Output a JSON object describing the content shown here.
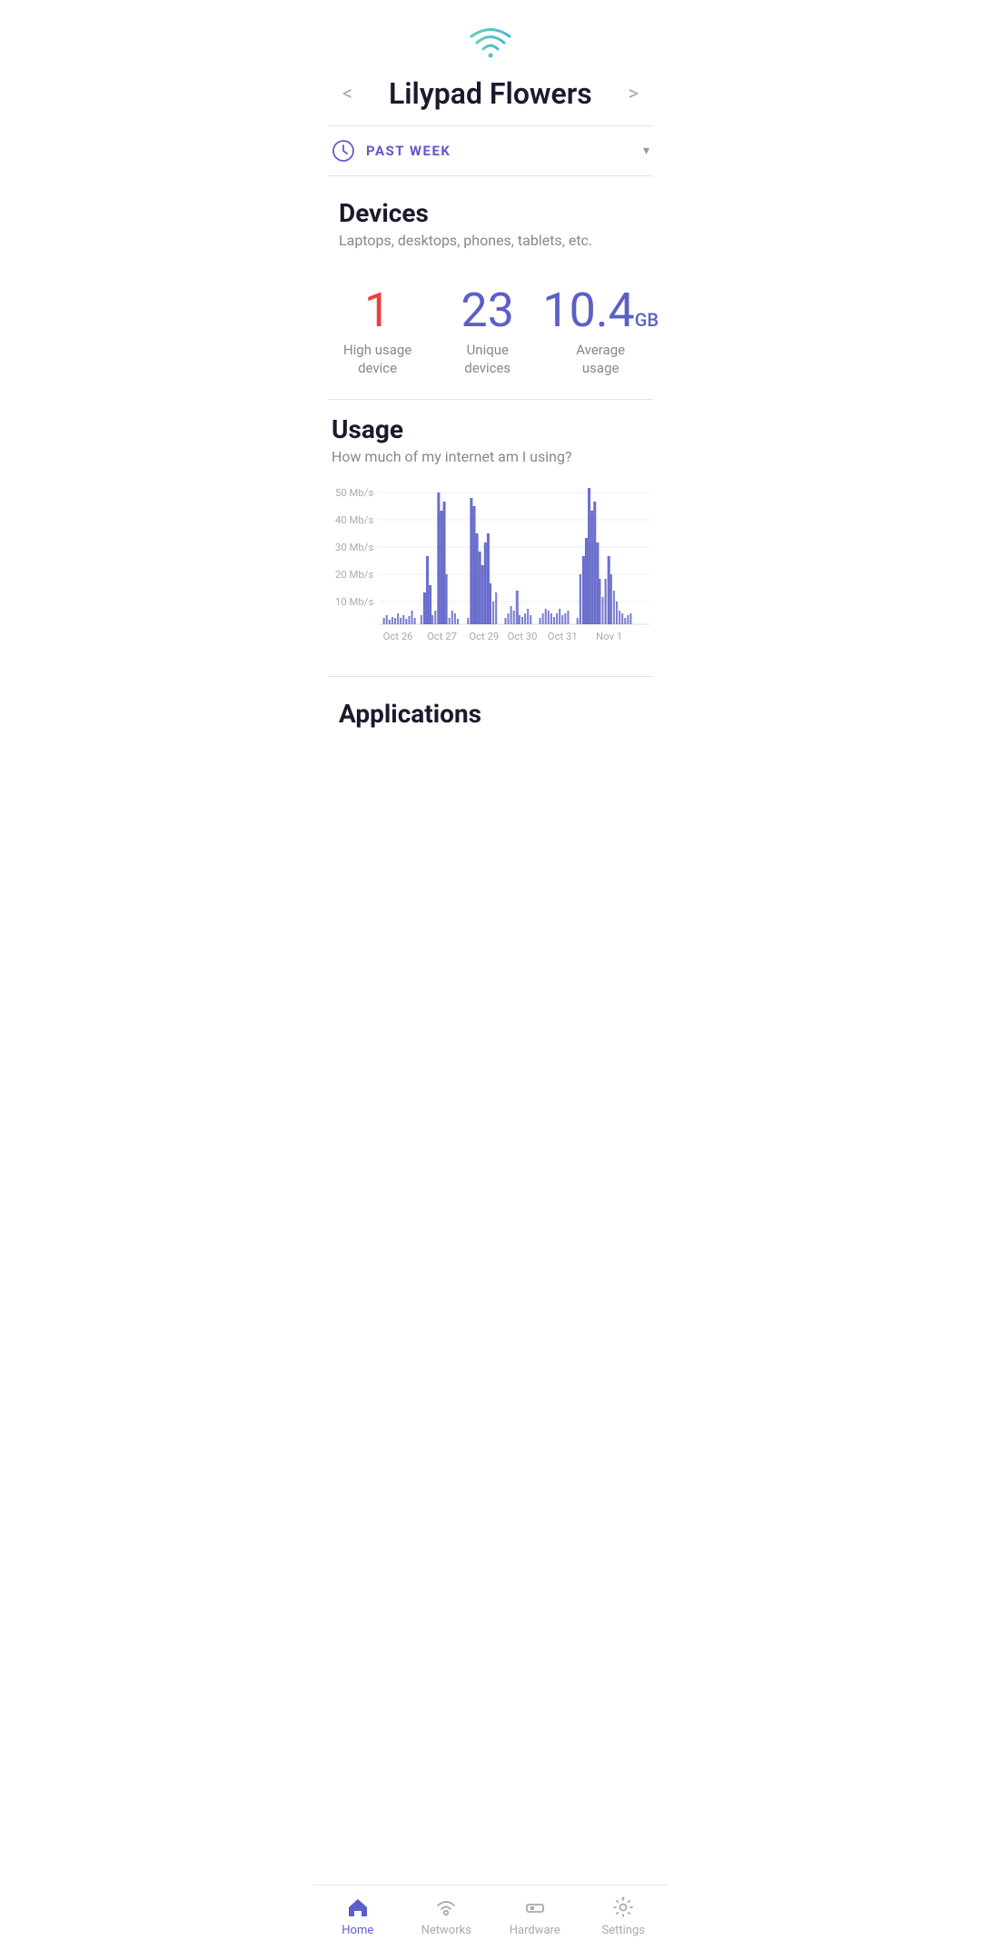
{
  "header": {
    "wifi_icon_alt": "wifi-signal-icon",
    "title": "Lilypad Flowers",
    "prev_label": "<",
    "next_label": ">"
  },
  "time_filter": {
    "label": "PAST WEEK",
    "clock_icon": "clock-icon",
    "dropdown_icon": "▾"
  },
  "devices": {
    "section_title": "Devices",
    "section_subtitle": "Laptops, desktops, phones, tablets, etc.",
    "stats": [
      {
        "value": "1",
        "label": "High usage\ndevice",
        "color": "red"
      },
      {
        "value": "23",
        "label": "Unique\ndevices",
        "color": "blue"
      },
      {
        "value": "10.4",
        "unit": "GB",
        "label": "Average\nusage",
        "color": "blue"
      }
    ]
  },
  "usage": {
    "section_title": "Usage",
    "section_subtitle": "How much of my internet am I using?",
    "y_labels": [
      "50 Mb/s",
      "40 Mb/s",
      "30 Mb/s",
      "20 Mb/s",
      "10 Mb/s"
    ],
    "x_labels": [
      "Oct 26",
      "Oct 27",
      "Oct 29",
      "Oct 30",
      "Oct 31",
      "Nov 1"
    ]
  },
  "applications": {
    "section_title": "Applications"
  },
  "bottom_nav": {
    "items": [
      {
        "label": "Home",
        "icon": "home-icon",
        "active": true
      },
      {
        "label": "Networks",
        "icon": "networks-icon",
        "active": false
      },
      {
        "label": "Hardware",
        "icon": "hardware-icon",
        "active": false
      },
      {
        "label": "Settings",
        "icon": "settings-icon",
        "active": false
      }
    ]
  }
}
